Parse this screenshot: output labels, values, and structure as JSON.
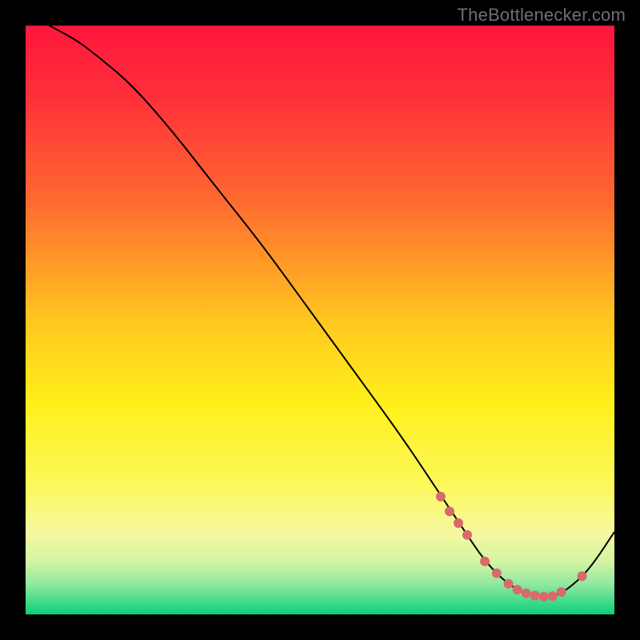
{
  "attribution": "TheBottlenecker.com",
  "chart_data": {
    "type": "line",
    "title": "",
    "xlabel": "",
    "ylabel": "",
    "xlim": [
      0,
      100
    ],
    "ylim": [
      0,
      100
    ],
    "series": [
      {
        "name": "curve",
        "x": [
          4,
          8,
          12,
          18,
          25,
          32,
          40,
          48,
          56,
          64,
          70,
          74,
          78,
          82,
          86,
          90,
          93,
          96,
          100
        ],
        "values": [
          100,
          98,
          95,
          90,
          82,
          73,
          63,
          52,
          41,
          30,
          21,
          15,
          9,
          5,
          3,
          3,
          5,
          8,
          14
        ]
      }
    ],
    "markers": {
      "name": "highlight-dots",
      "x": [
        70.5,
        72,
        73.5,
        75,
        78,
        80,
        82,
        83.5,
        85,
        86.5,
        88,
        89.5,
        91,
        94.5
      ],
      "values": [
        20,
        17.5,
        15.5,
        13.5,
        9,
        7,
        5.2,
        4.2,
        3.6,
        3.2,
        3,
        3.1,
        3.8,
        6.5
      ],
      "radius": 6,
      "fill": "#d86a6c"
    },
    "background_gradient": {
      "stops": [
        {
          "offset": 0.0,
          "color": "#ff163c"
        },
        {
          "offset": 0.12,
          "color": "#ff2f3a"
        },
        {
          "offset": 0.3,
          "color": "#ff6a30"
        },
        {
          "offset": 0.5,
          "color": "#ffc61f"
        },
        {
          "offset": 0.64,
          "color": "#fff01a"
        },
        {
          "offset": 0.78,
          "color": "#fcf85a"
        },
        {
          "offset": 0.86,
          "color": "#f6f9a0"
        },
        {
          "offset": 0.91,
          "color": "#d4f4a2"
        },
        {
          "offset": 0.95,
          "color": "#8de8a0"
        },
        {
          "offset": 0.985,
          "color": "#2fd885"
        },
        {
          "offset": 1.0,
          "color": "#0ecf77"
        }
      ]
    },
    "line_style": {
      "stroke": "#000000",
      "width": 2
    }
  }
}
